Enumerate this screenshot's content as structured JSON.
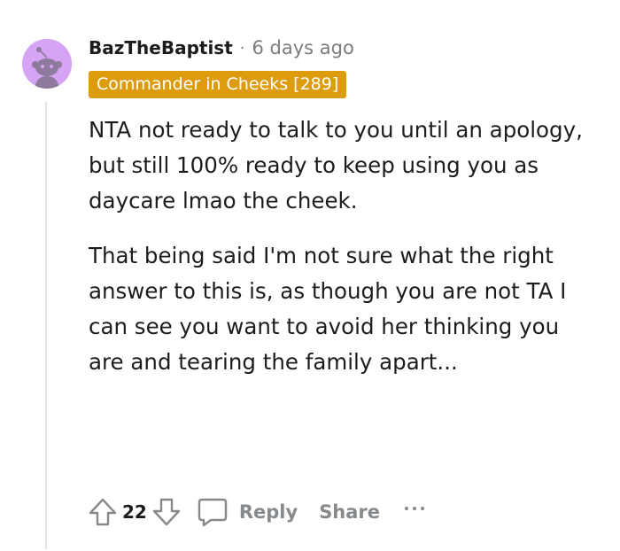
{
  "comment": {
    "username": "BazTheBaptist",
    "separator": "·",
    "timestamp": "6 days ago",
    "flair": "Commander in Cheeks [289]",
    "paragraphs": [
      "NTA not ready to talk to you until an apology, but still 100% ready to keep using you as daycare lmao the cheek.",
      "That being said I'm not sure what the right answer to this is, as though you are not TA I can see you want to avoid her thinking you are and tearing the family apart..."
    ],
    "score": "22",
    "reply_label": "Reply",
    "share_label": "Share"
  },
  "colors": {
    "avatar_bg": "#d6a3f5",
    "flair_bg": "#dc9c0d",
    "meta_gray": "#878a8c"
  },
  "icons": {
    "avatar": "snoo-avatar-icon",
    "upvote": "arrow-up-icon",
    "downvote": "arrow-down-icon",
    "reply": "comment-bubble-icon",
    "more": "more-dots-icon"
  }
}
